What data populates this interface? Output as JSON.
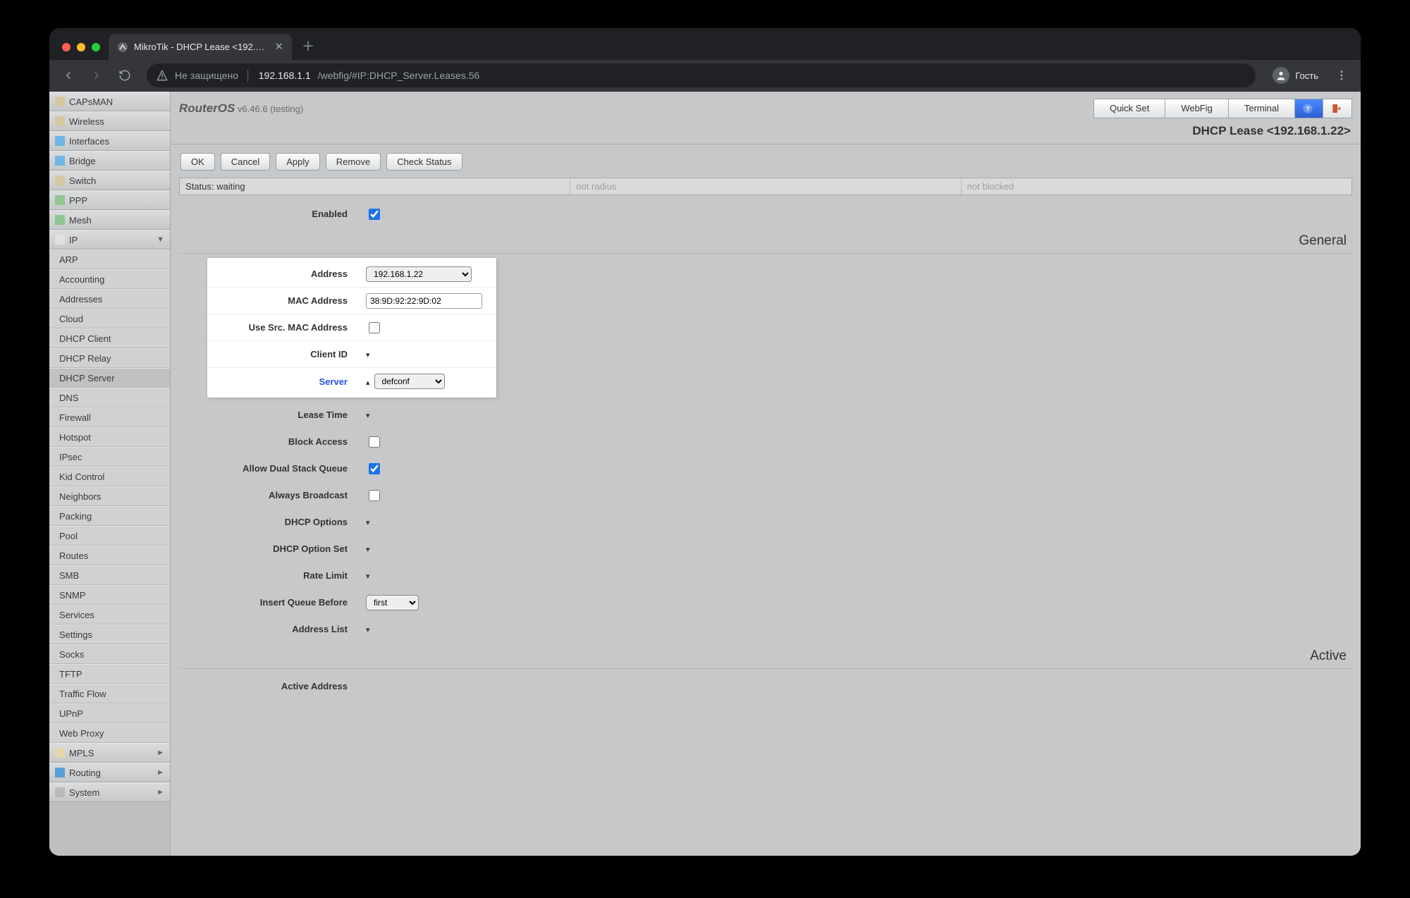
{
  "browser": {
    "tab_title": "MikroTik - DHCP Lease <192.1…",
    "insecure_label": "Не защищено",
    "url_host": "192.168.1.1",
    "url_path": "/webfig/#IP:DHCP_Server.Leases.56",
    "profile_label": "Гость"
  },
  "sidebar": {
    "items_top": [
      {
        "label": "CAPsMAN",
        "icon": "ic-capsman"
      },
      {
        "label": "Wireless",
        "icon": "ic-wireless"
      },
      {
        "label": "Interfaces",
        "icon": "ic-interfaces"
      },
      {
        "label": "Bridge",
        "icon": "ic-bridge"
      },
      {
        "label": "Switch",
        "icon": "ic-switch"
      },
      {
        "label": "PPP",
        "icon": "ic-ppp"
      },
      {
        "label": "Mesh",
        "icon": "ic-mesh"
      }
    ],
    "ip_label": "IP",
    "ip_items": [
      "ARP",
      "Accounting",
      "Addresses",
      "Cloud",
      "DHCP Client",
      "DHCP Relay",
      "DHCP Server",
      "DNS",
      "Firewall",
      "Hotspot",
      "IPsec",
      "Kid Control",
      "Neighbors",
      "Packing",
      "Pool",
      "Routes",
      "SMB",
      "SNMP",
      "Services",
      "Settings",
      "Socks",
      "TFTP",
      "Traffic Flow",
      "UPnP",
      "Web Proxy"
    ],
    "items_bottom": [
      {
        "label": "MPLS",
        "icon": "ic-mpls",
        "exp": "►"
      },
      {
        "label": "Routing",
        "icon": "ic-routing",
        "exp": "►"
      },
      {
        "label": "System",
        "icon": "ic-system",
        "exp": "►"
      }
    ]
  },
  "header": {
    "brand": "RouterOS",
    "version": "v6.46.6 (testing)",
    "tabs": [
      "Quick Set",
      "WebFig",
      "Terminal"
    ],
    "page_title": "DHCP Lease <192.168.1.22>"
  },
  "buttons": {
    "ok": "OK",
    "cancel": "Cancel",
    "apply": "Apply",
    "remove": "Remove",
    "check": "Check Status"
  },
  "status": {
    "s1": "Status: waiting",
    "s2": "not radius",
    "s3": "not blocked"
  },
  "form": {
    "enabled_label": "Enabled",
    "enabled_value": true,
    "general_section": "General",
    "address_label": "Address",
    "address_value": "192.168.1.22",
    "mac_label": "MAC Address",
    "mac_value": "38:9D:92:22:9D:02",
    "usesrc_label": "Use Src. MAC Address",
    "usesrc_value": false,
    "clientid_label": "Client ID",
    "server_label": "Server",
    "server_value": "defconf",
    "leasetime_label": "Lease Time",
    "blockaccess_label": "Block Access",
    "blockaccess_value": false,
    "dualstack_label": "Allow Dual Stack Queue",
    "dualstack_value": true,
    "alwaysbc_label": "Always Broadcast",
    "alwaysbc_value": false,
    "dhcpopts_label": "DHCP Options",
    "dhcpoptset_label": "DHCP Option Set",
    "ratelimit_label": "Rate Limit",
    "insertq_label": "Insert Queue Before",
    "insertq_value": "first",
    "addresslist_label": "Address List",
    "active_section": "Active",
    "activeaddr_label": "Active Address"
  }
}
